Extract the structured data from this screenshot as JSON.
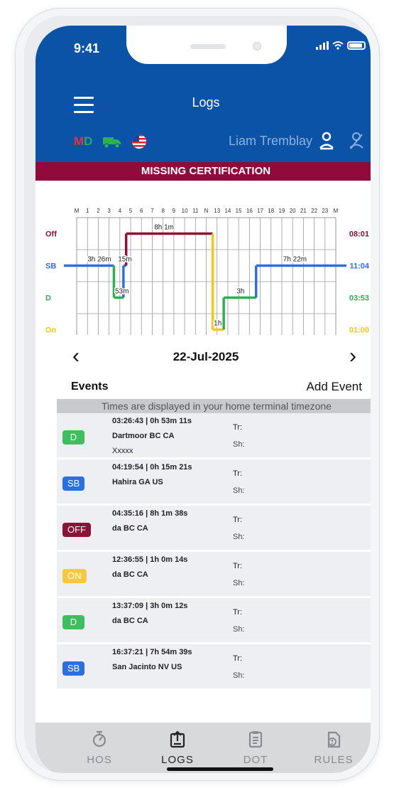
{
  "status_bar": {
    "time": "9:41"
  },
  "header": {
    "title": "Logs",
    "md_m": "M",
    "md_d": "D",
    "user_name": "Liam Tremblay"
  },
  "banner": {
    "text": "MISSING CERTIFICATION"
  },
  "chart_data": {
    "type": "line",
    "title": "",
    "hour_labels": [
      "M",
      "1",
      "2",
      "3",
      "4",
      "5",
      "6",
      "7",
      "8",
      "9",
      "10",
      "11",
      "N",
      "13",
      "14",
      "15",
      "16",
      "17",
      "18",
      "19",
      "20",
      "21",
      "22",
      "23",
      "M"
    ],
    "rows": [
      "Off",
      "SB",
      "D",
      "On"
    ],
    "row_totals": [
      "08:01",
      "11:04",
      "03:53",
      "01:00"
    ],
    "row_colors": {
      "Off": "#8b1335",
      "SB": "#2e6fe0",
      "D": "#2bb24e",
      "On": "#f5c518"
    },
    "segments": [
      {
        "status": "SB",
        "start": 0.0,
        "end": 3.45,
        "label": "3h 26m"
      },
      {
        "status": "D",
        "start": 3.45,
        "end": 4.33,
        "label": "53m"
      },
      {
        "status": "SB",
        "start": 4.33,
        "end": 4.58,
        "label": "15m"
      },
      {
        "status": "Off",
        "start": 4.58,
        "end": 12.6,
        "label": "8h 1m"
      },
      {
        "status": "On",
        "start": 12.6,
        "end": 13.62,
        "label": "1h"
      },
      {
        "status": "D",
        "start": 13.62,
        "end": 16.62,
        "label": "3h"
      },
      {
        "status": "SB",
        "start": 16.62,
        "end": 24.0,
        "label": "7h 22m"
      }
    ]
  },
  "date_nav": {
    "prev": "‹",
    "date": "22-Jul-2025",
    "next": "›"
  },
  "events_section": {
    "title": "Events",
    "add_label": "Add Event",
    "tz_note": "Times are displayed in your home terminal timezone",
    "tr_label": "Tr:",
    "sh_label": "Sh:",
    "items": [
      {
        "badge": "D",
        "color": "#3cbf5c",
        "time": "03:26:43 | 0h 53m 11s",
        "location": "Dartmoor BC CA",
        "note": "Xxxxx"
      },
      {
        "badge": "SB",
        "color": "#2e6fe0",
        "time": "04:19:54 | 0h 15m 21s",
        "location": "Hahira GA US",
        "note": ""
      },
      {
        "badge": "OFF",
        "color": "#8b1335",
        "time": "04:35:16 | 8h 1m 38s",
        "location": "da BC CA",
        "note": ""
      },
      {
        "badge": "ON",
        "color": "#f7c93c",
        "time": "12:36:55 | 1h 0m 14s",
        "location": "da BC CA",
        "note": ""
      },
      {
        "badge": "D",
        "color": "#3cbf5c",
        "time": "13:37:09 | 3h 0m 12s",
        "location": "da BC CA",
        "note": ""
      },
      {
        "badge": "SB",
        "color": "#2e6fe0",
        "time": "16:37:21 | 7h 54m 39s",
        "location": "San Jacinto NV US",
        "note": ""
      }
    ]
  },
  "tabs": [
    {
      "label": "HOS",
      "icon": "stopwatch-icon",
      "active": false
    },
    {
      "label": "LOGS",
      "icon": "upload-doc-icon",
      "active": true
    },
    {
      "label": "DOT",
      "icon": "clipboard-icon",
      "active": false
    },
    {
      "label": "RULES",
      "icon": "rules-icon",
      "active": false
    }
  ],
  "colors": {
    "brand_blue": "#0b53a6",
    "banner_red": "#920a3c"
  }
}
